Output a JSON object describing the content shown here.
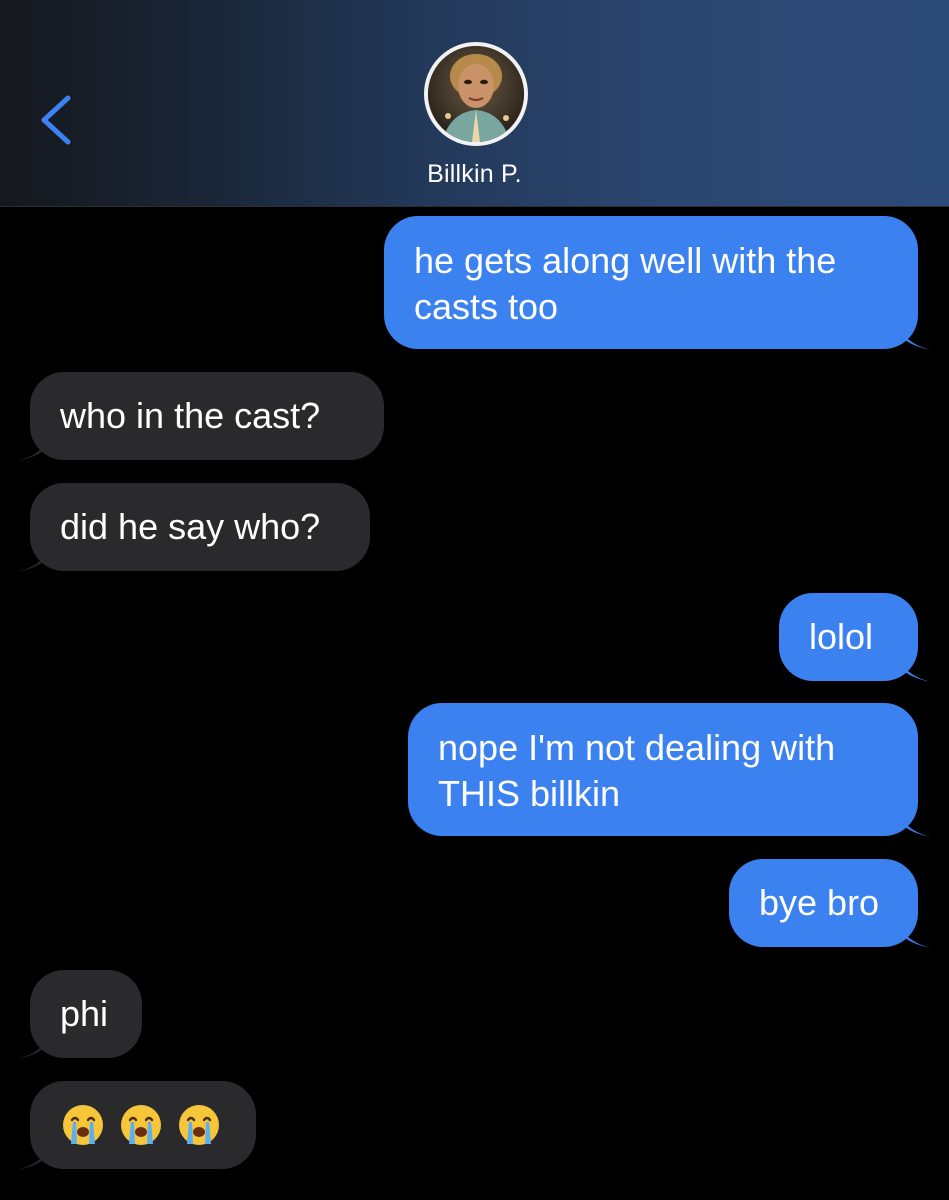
{
  "header": {
    "contact_name": "Billkin P.",
    "back_icon": "chevron-left-icon",
    "avatar_icon": "contact-avatar"
  },
  "colors": {
    "outgoing_bubble": "#3b82f0",
    "incoming_bubble": "#2a2a2c",
    "back_chevron": "#3d82f2",
    "background": "#000000"
  },
  "messages": [
    {
      "direction": "outgoing",
      "lines": [
        "he gets along well with the",
        "casts too"
      ]
    },
    {
      "direction": "incoming",
      "lines": [
        "who in the cast?"
      ]
    },
    {
      "direction": "incoming",
      "lines": [
        "did he say who?"
      ]
    },
    {
      "direction": "outgoing",
      "lines": [
        "lolol"
      ]
    },
    {
      "direction": "outgoing",
      "lines": [
        "nope I'm not dealing with",
        "THIS billkin"
      ]
    },
    {
      "direction": "outgoing",
      "lines": [
        "bye bro"
      ]
    },
    {
      "direction": "incoming",
      "lines": [
        "phi"
      ]
    },
    {
      "direction": "incoming",
      "emoji": [
        "loudly-crying-face-emoji",
        "loudly-crying-face-emoji",
        "loudly-crying-face-emoji"
      ]
    }
  ]
}
